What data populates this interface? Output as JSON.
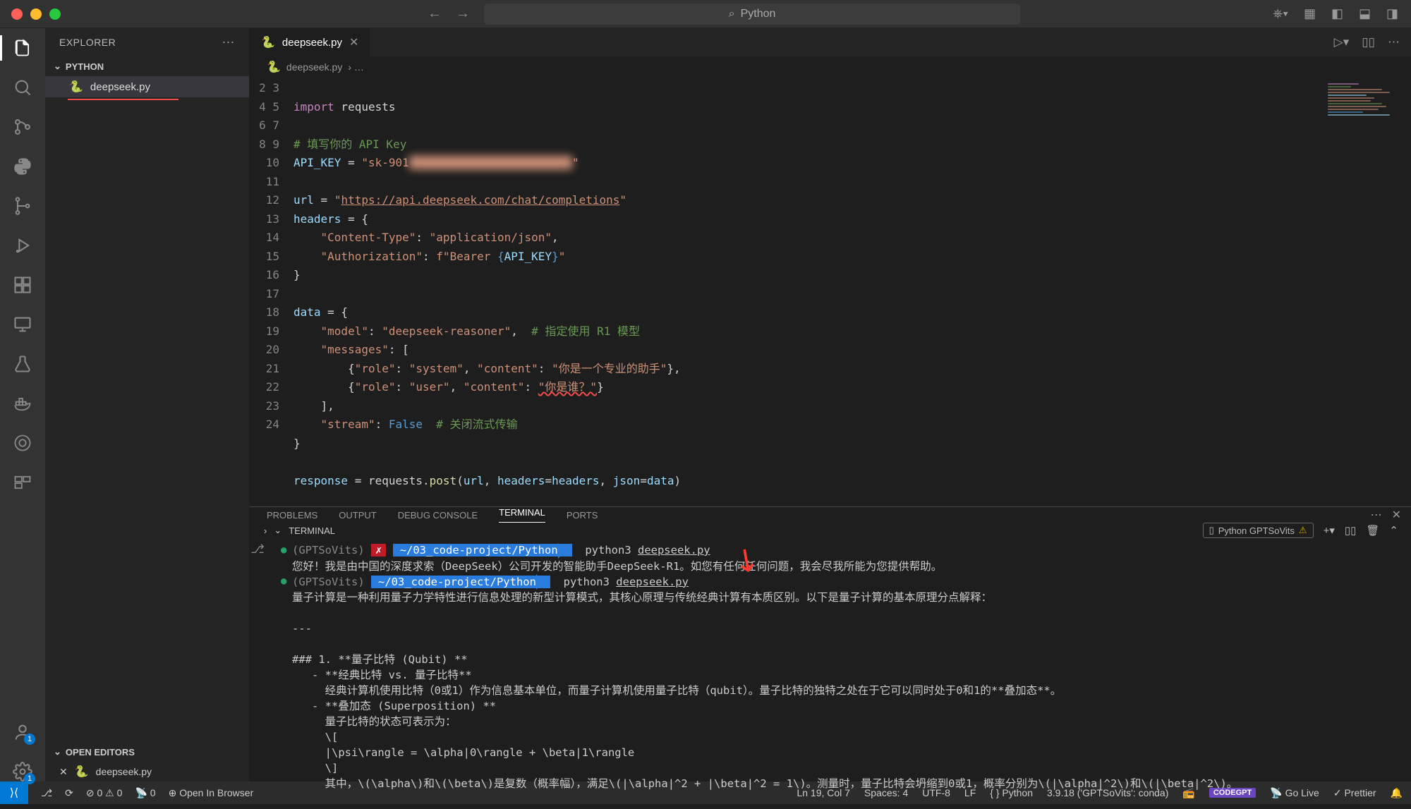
{
  "titlebar": {
    "search": "Python"
  },
  "sidebar": {
    "title": "EXPLORER",
    "project": "PYTHON",
    "file": "deepseek.py",
    "openEditors": "OPEN EDITORS",
    "openFile": "deepseek.py"
  },
  "tab": {
    "name": "deepseek.py"
  },
  "breadcrumb": {
    "file": "deepseek.py",
    "sep": "› …"
  },
  "code": {
    "lines": [
      "2",
      "3",
      "4",
      "5",
      "6",
      "7",
      "8",
      "9",
      "10",
      "11",
      "12",
      "13",
      "14",
      "15",
      "16",
      "17",
      "18",
      "19",
      "20",
      "21",
      "22",
      "23",
      "24"
    ],
    "l3a": "import",
    "l3b": " requests",
    "l5": "# 填写你的 API Key",
    "l6a": "API_KEY",
    "l6b": " = ",
    "l6c": "\"sk-901",
    "l6d": "\"",
    "l8a": "url",
    "l8b": " = ",
    "l8c": "\"",
    "l8d": "https://api.deepseek.com/chat/completions",
    "l8e": "\"",
    "l9a": "headers",
    "l9b": " = {",
    "l10a": "    ",
    "l10b": "\"Content-Type\"",
    "l10c": ": ",
    "l10d": "\"application/json\"",
    "l10e": ",",
    "l11a": "    ",
    "l11b": "\"Authorization\"",
    "l11c": ": ",
    "l11d": "f\"Bearer ",
    "l11e": "{",
    "l11f": "API_KEY",
    "l11g": "}",
    "l11h": "\"",
    "l12": "}",
    "l14a": "data",
    "l14b": " = {",
    "l15a": "    ",
    "l15b": "\"model\"",
    "l15c": ": ",
    "l15d": "\"deepseek-reasoner\"",
    "l15e": ",  ",
    "l15f": "# 指定使用 R1 模型",
    "l16a": "    ",
    "l16b": "\"messages\"",
    "l16c": ": [",
    "l17a": "        {",
    "l17b": "\"role\"",
    "l17c": ": ",
    "l17d": "\"system\"",
    "l17e": ", ",
    "l17f": "\"content\"",
    "l17g": ": ",
    "l17h": "\"你是一个专业的助手\"",
    "l17i": "},",
    "l18a": "        {",
    "l18b": "\"role\"",
    "l18c": ": ",
    "l18d": "\"user\"",
    "l18e": ", ",
    "l18f": "\"content\"",
    "l18g": ": ",
    "l18h": "\"你是谁？\"",
    "l18i": "}",
    "l19": "    ],",
    "l20a": "    ",
    "l20b": "\"stream\"",
    "l20c": ": ",
    "l20d": "False",
    "l20e": "  ",
    "l20f": "# 关闭流式传输",
    "l21": "}",
    "l23a": "response",
    "l23b": " = requests.",
    "l23c": "post",
    "l23d": "(",
    "l23e": "url",
    "l23f": ", ",
    "l23g": "headers",
    "l23h": "=",
    "l23i": "headers",
    "l23j": ", ",
    "l23k": "json",
    "l23l": "=",
    "l23m": "data",
    "l23n": ")"
  },
  "panel": {
    "tabs": {
      "problems": "PROBLEMS",
      "output": "OUTPUT",
      "debug": "DEBUG CONSOLE",
      "terminal": "TERMINAL",
      "ports": "PORTS"
    },
    "sub": "TERMINAL",
    "env": "Python GPTSoVits"
  },
  "terminal": {
    "env": "(GPTSoVits)",
    "path": "~/03_code-project/Python",
    "cmd": "python3 ",
    "cmdFile": "deepseek.py",
    "out1": "您好！我是由中国的深度求索（DeepSeek）公司开发的智能助手DeepSeek-R1。如您有任何任何问题，我会尽我所能为您提供帮助。",
    "out2": "量子计算是一种利用量子力学特性进行信息处理的新型计算模式，其核心原理与传统经典计算有本质区别。以下是量子计算的基本原理分点解释：",
    "out3": "---",
    "out4": "### 1. **量子比特 (Qubit) **",
    "out5": "   - **经典比特 vs. 量子比特**",
    "out6": "     经典计算机使用比特（0或1）作为信息基本单位，而量子计算机使用量子比特（qubit）。量子比特的独特之处在于它可以同时处于0和1的**叠加态**。",
    "out7": "   - **叠加态 (Superposition) **",
    "out8": "     量子比特的状态可表示为：",
    "out9": "     \\[",
    "out10": "     |\\psi\\rangle = \\alpha|0\\rangle + \\beta|1\\rangle",
    "out11": "     \\]",
    "out12": "     其中，\\(\\alpha\\)和\\(\\beta\\)是复数（概率幅），满足\\(|\\alpha|^2 + |\\beta|^2 = 1\\)。测量时，量子比特会坍缩到0或1，概率分别为\\(|\\alpha|^2\\)和\\(|\\beta|^2\\)。"
  },
  "status": {
    "errors": "0",
    "warnings": "0",
    "ports": "0",
    "openBrowser": "Open In Browser",
    "pos": "Ln 19, Col 7",
    "spaces": "Spaces: 4",
    "enc": "UTF-8",
    "eol": "LF",
    "lang": "Python",
    "pyver": "3.9.18 ('GPTSoVits': conda)",
    "golive": "Go Live",
    "prettier": "Prettier"
  }
}
